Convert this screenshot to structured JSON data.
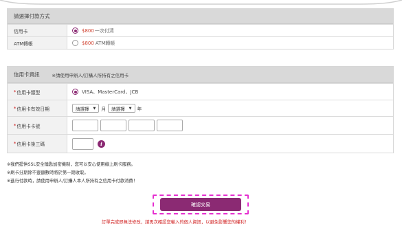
{
  "payment_method": {
    "header": "請選擇付款方式",
    "options": [
      {
        "label": "信用卡",
        "price": "$800",
        "desc": "一次付清",
        "selected": true
      },
      {
        "label": "ATM轉帳",
        "price": "$800",
        "desc": "ATM轉帳",
        "selected": false
      }
    ]
  },
  "card_info": {
    "header": "信用卡資訊",
    "note": "※請使用申辦人/訂購人所持有之信用卡",
    "card_type": {
      "label": "信用卡類型",
      "value": "VISA、MasterCard、JCB"
    },
    "expiry": {
      "label": "信用卡有效日期",
      "month_placeholder": "請選擇",
      "month_unit": "月",
      "year_placeholder": "請選擇",
      "year_unit": "年"
    },
    "card_number": {
      "label": "信用卡卡號"
    },
    "cvv": {
      "label": "信用卡後三碼",
      "info_icon": "info-icon"
    },
    "required_mark": "*"
  },
  "notes": [
    "※我們提供SSL安全鑰匙加密機制，您可以安心使用線上刷卡服務。",
    "※刷卡分期除不靈額數時將於第一期收取。",
    "※進行付款時，請使用申辦人/訂購人本人所持有之信用卡付款消費！"
  ],
  "confirm_label": "確認交易",
  "warning": "訂單完成即無法修改，請再次確認您輸入的個人資訊，以避免影響您的權利！",
  "colors": {
    "accent": "#8b2a73",
    "price": "#d0402e",
    "warning": "#d01f1f",
    "highlight": "#e62fd0"
  }
}
